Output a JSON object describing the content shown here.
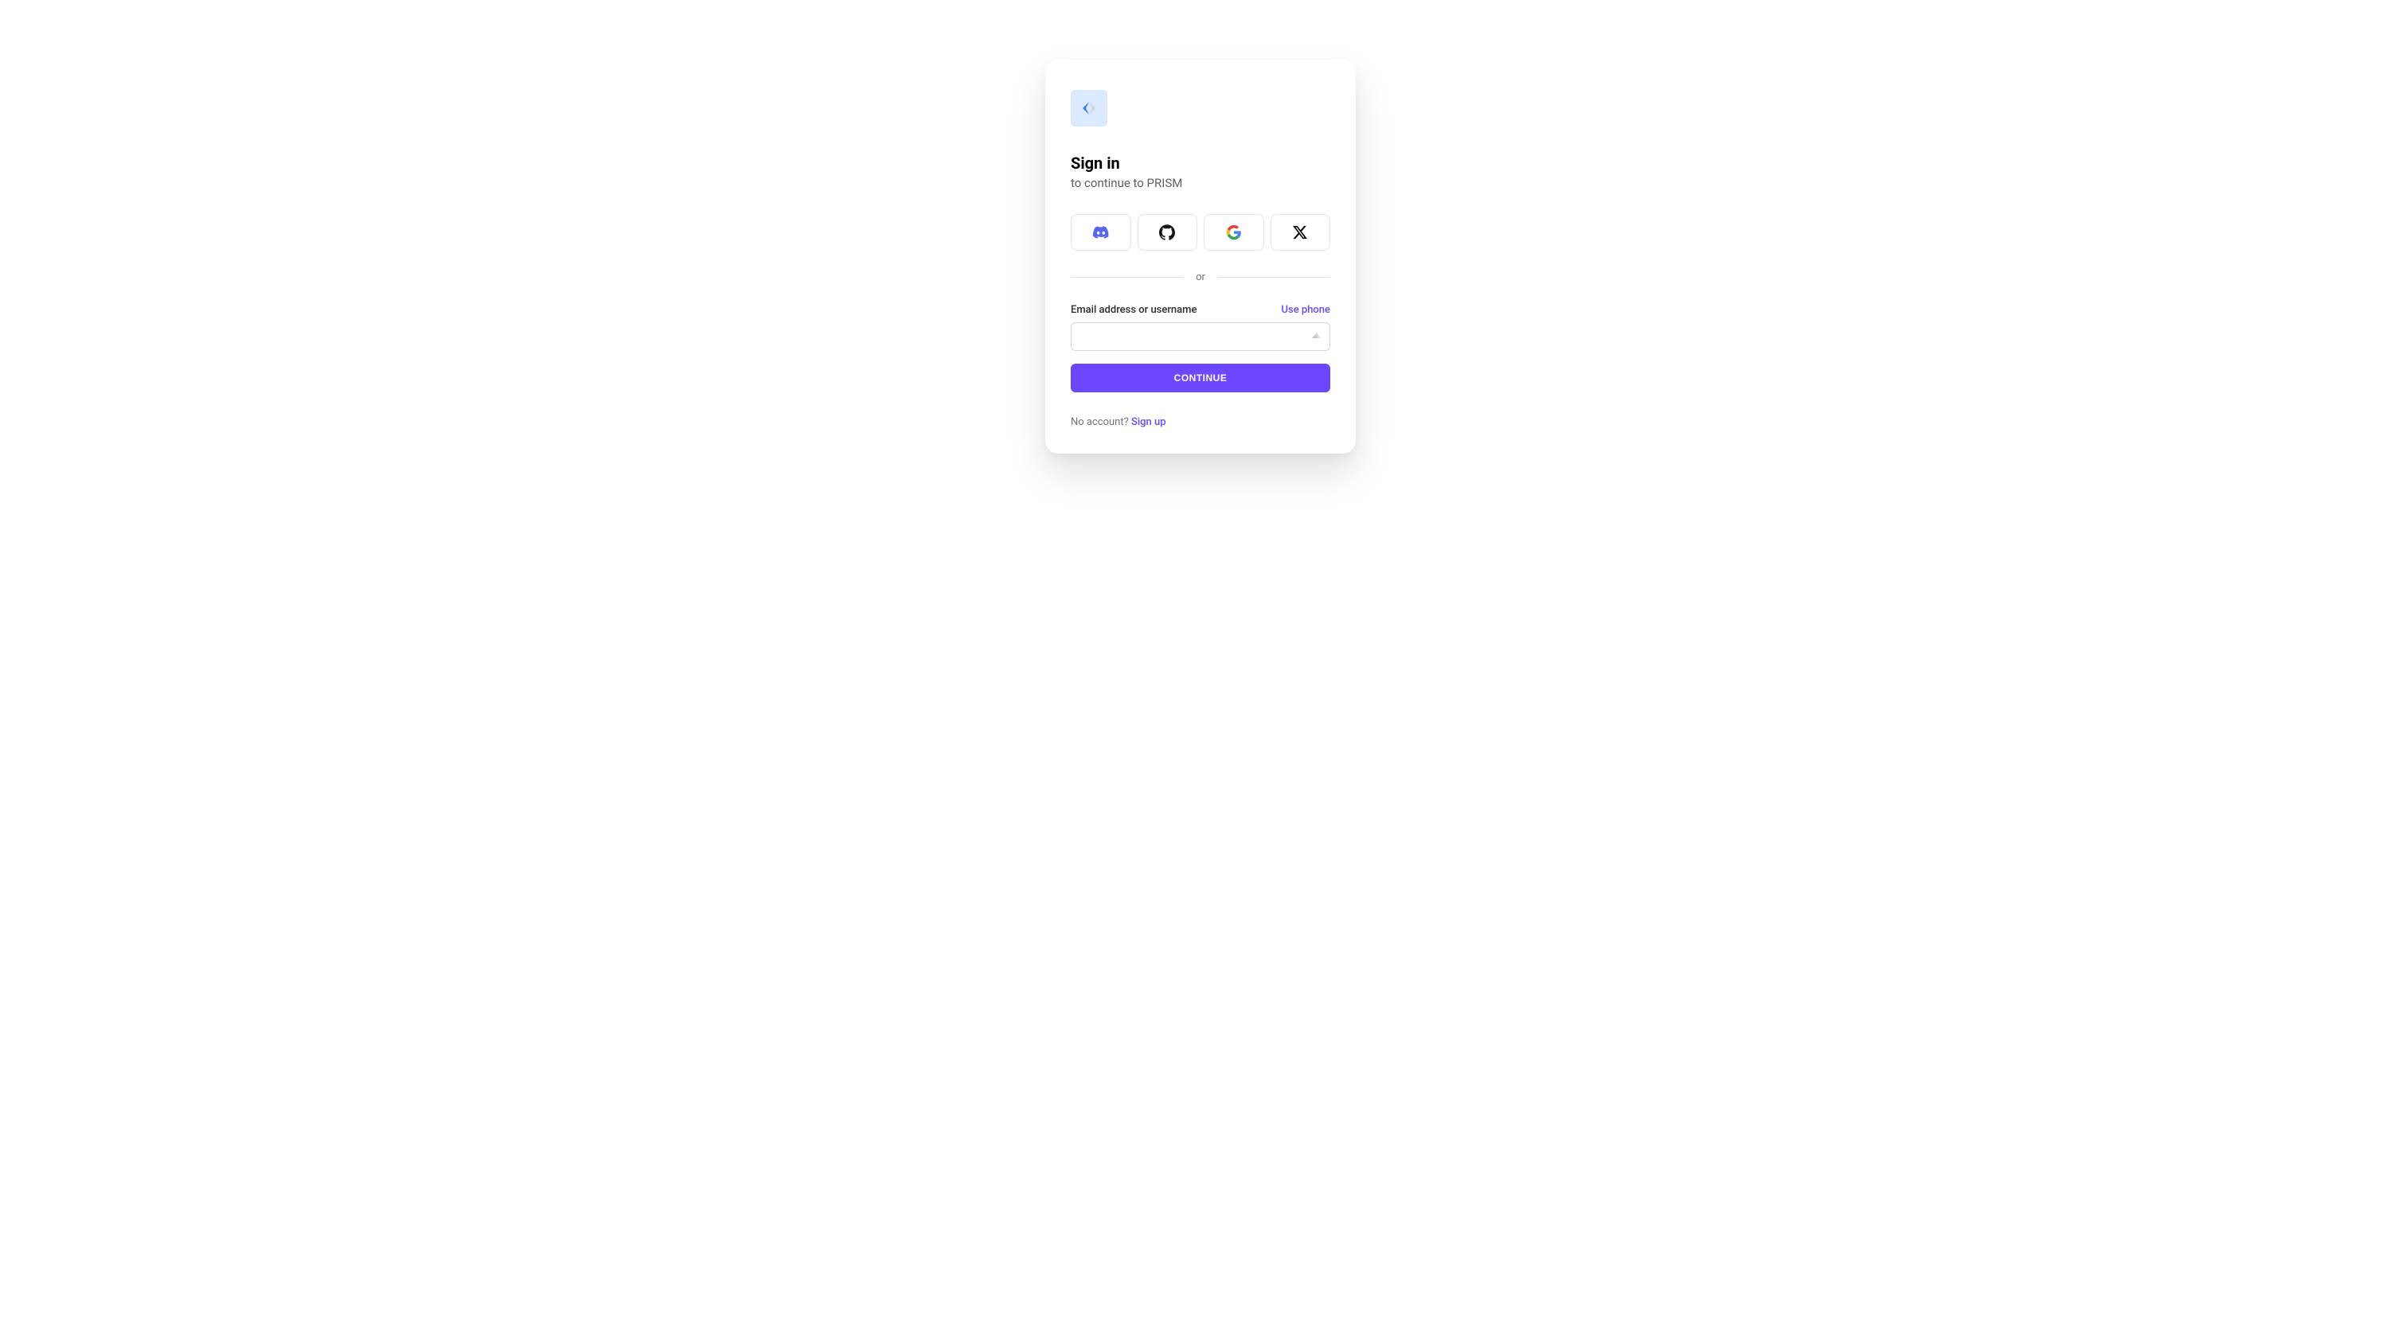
{
  "header": {
    "title": "Sign in",
    "subtitle": "to continue to PRISM"
  },
  "social": {
    "providers": [
      "discord",
      "github",
      "google",
      "x"
    ]
  },
  "divider": {
    "text": "or"
  },
  "form": {
    "email_label": "Email address or username",
    "use_phone_label": "Use phone",
    "email_value": "",
    "continue_label": "CONTINUE"
  },
  "footer": {
    "no_account_text": "No account? ",
    "signup_label": "Sign up"
  },
  "colors": {
    "accent": "#6c47ff",
    "logo_bg": "#dbeafe"
  }
}
